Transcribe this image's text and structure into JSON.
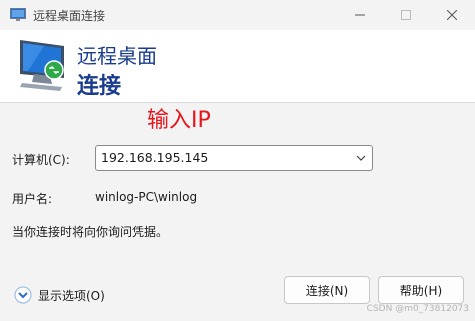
{
  "window": {
    "title": "远程桌面连接",
    "icon": "remote-desktop-icon"
  },
  "header": {
    "line1": "远程桌面",
    "line2": "连接"
  },
  "annotation": "输入IP",
  "form": {
    "computer_label": "计算机(C):",
    "computer_value": "192.168.195.145",
    "username_label": "用户名:",
    "username_value": "winlog-PC\\winlog",
    "notice": "当你连接时将向你询问凭据。"
  },
  "footer": {
    "options_label": "显示选项(O)",
    "connect_label": "连接(N)",
    "help_label": "帮助(H)"
  },
  "watermark": "CSDN @m0_73812073",
  "colors": {
    "heading": "#1a3c8e",
    "annotation": "#e8141c",
    "options_icon": "#2b6cd1"
  }
}
